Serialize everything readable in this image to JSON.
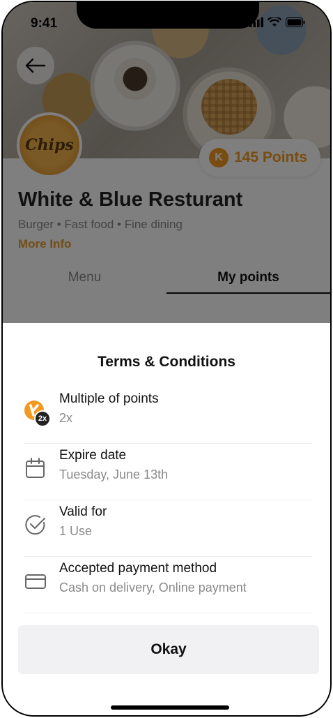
{
  "status_bar": {
    "time": "9:41"
  },
  "restaurant": {
    "logo_text": "Chips",
    "name": "White & Blue Resturant",
    "tags": "Burger • Fast food • Fine dining",
    "more_info": "More Info",
    "points_badge": "K",
    "points": "145 Points"
  },
  "tabs": [
    {
      "label": "Menu",
      "active": false
    },
    {
      "label": "My points",
      "active": true
    }
  ],
  "sheet": {
    "title": "Terms & Conditions",
    "rows": [
      {
        "icon": "points-multiplier-icon",
        "badge": "2x",
        "label": "Multiple of points",
        "value": "2x"
      },
      {
        "icon": "calendar-icon",
        "label": "Expire date",
        "value": "Tuesday, June 13th"
      },
      {
        "icon": "check-circle-icon",
        "label": "Valid for",
        "value": "1 Use"
      },
      {
        "icon": "credit-card-icon",
        "label": "Accepted payment method",
        "value": "Cash on delivery, Online payment"
      }
    ],
    "okay_label": "Okay"
  },
  "colors": {
    "accent": "#f29a1f",
    "muted": "#8a8a8a",
    "button_bg": "#f1f1f4"
  }
}
